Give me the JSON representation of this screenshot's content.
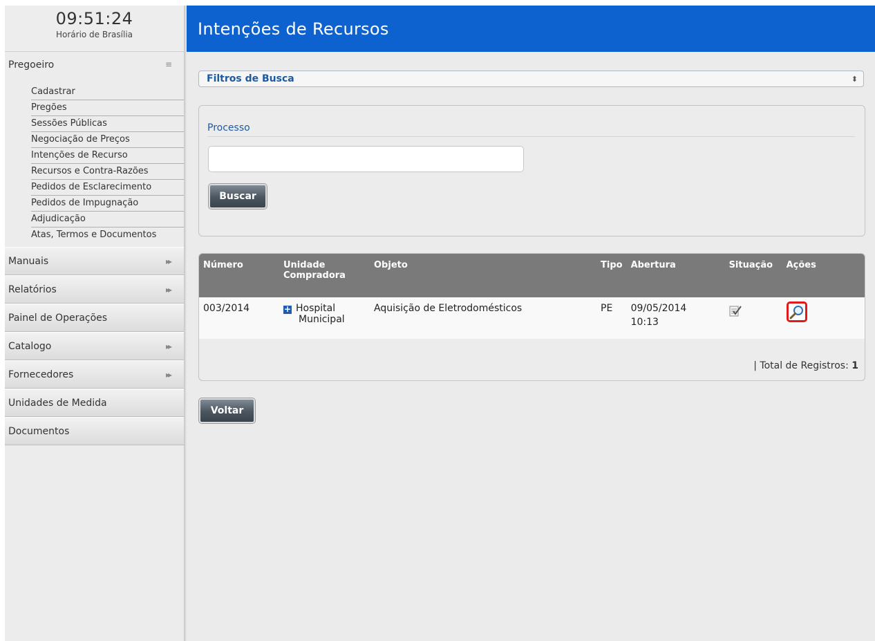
{
  "clock": {
    "time": "09:51:24",
    "timezone": "Horário de Brasília"
  },
  "sidebar": {
    "pregoeiro": {
      "label": "Pregoeiro",
      "items": [
        "Cadastrar",
        "Pregões",
        "Sessões Públicas",
        "Negociação de Preços",
        "Intenções de Recurso",
        "Recursos e Contra-Razões",
        "Pedidos de Esclarecimento",
        "Pedidos de Impugnação",
        "Adjudicação",
        "Atas, Termos e Documentos"
      ]
    },
    "menus": [
      {
        "label": "Manuais"
      },
      {
        "label": "Relatórios"
      },
      {
        "label": "Painel de Operações"
      },
      {
        "label": "Catalogo"
      },
      {
        "label": "Fornecedores"
      },
      {
        "label": "Unidades de Medida"
      },
      {
        "label": "Documentos"
      }
    ]
  },
  "header": {
    "title": "Intenções de Recursos"
  },
  "filters": {
    "title": "Filtros de Busca",
    "processo_label": "Processo",
    "processo_value": "",
    "search_button": "Buscar"
  },
  "table": {
    "headers": {
      "numero": "Número",
      "unidade_line1": "Unidade",
      "unidade_line2": "Compradora",
      "objeto": "Objeto",
      "tipo": "Tipo",
      "abertura": "Abertura",
      "situacao": "Situação",
      "acoes": "Ações"
    },
    "rows": [
      {
        "numero": "003/2014",
        "unidade_line1": "Hospital",
        "unidade_line2": "Municipal",
        "objeto": "Aquisição de Eletrodomésticos",
        "tipo": "PE",
        "abertura_date": "09/05/2014",
        "abertura_time": "10:13",
        "situacao_icon": "checklist-icon",
        "acao_icon": "magnifier-icon"
      }
    ],
    "total_prefix": "| Total de Registros:",
    "total_value": "1"
  },
  "back_button": "Voltar",
  "colors": {
    "header_blue": "#0d62d0",
    "link_blue": "#1d5aa0",
    "highlight_red": "#e0191b"
  }
}
